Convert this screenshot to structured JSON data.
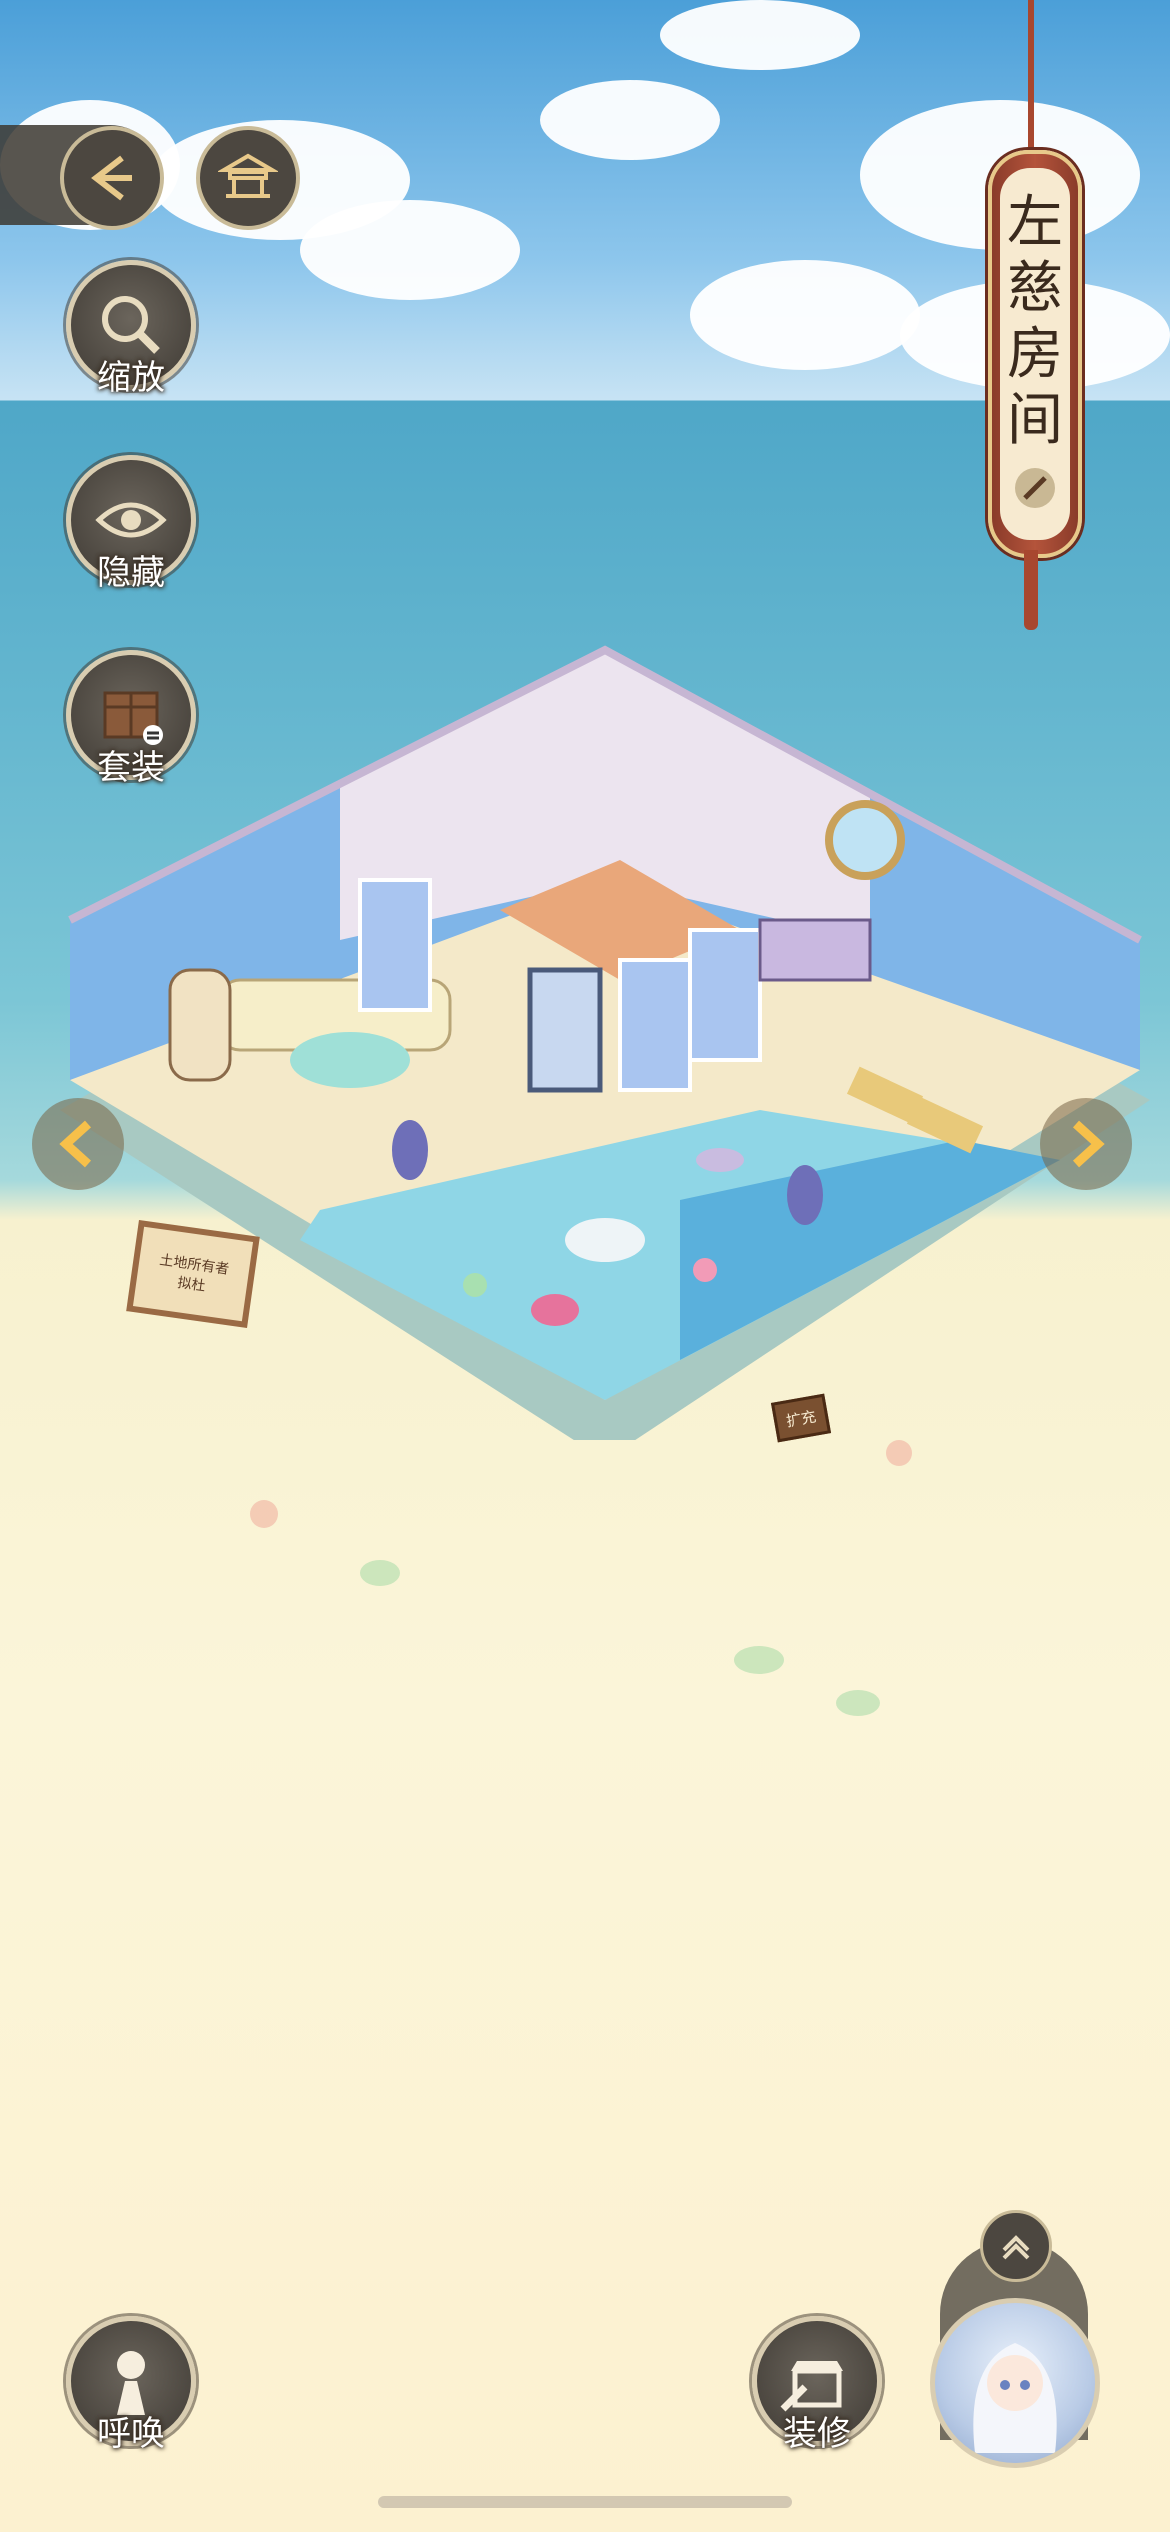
{
  "room_title": [
    "左",
    "慈",
    "房",
    "间"
  ],
  "left_menu": {
    "zoom_label": "缩放",
    "hide_label": "隐藏",
    "set_label": "套装"
  },
  "bottom_menu": {
    "summon_label": "呼唤",
    "decorate_label": "装修"
  },
  "signs": {
    "land_sign_line1": "土地所有者",
    "land_sign_line2": "拟杜",
    "expand_sign": "扩充"
  },
  "colors": {
    "accent_gold": "#f7c04a",
    "banner_red": "#a8472f",
    "button_dark": "#4c4740"
  }
}
